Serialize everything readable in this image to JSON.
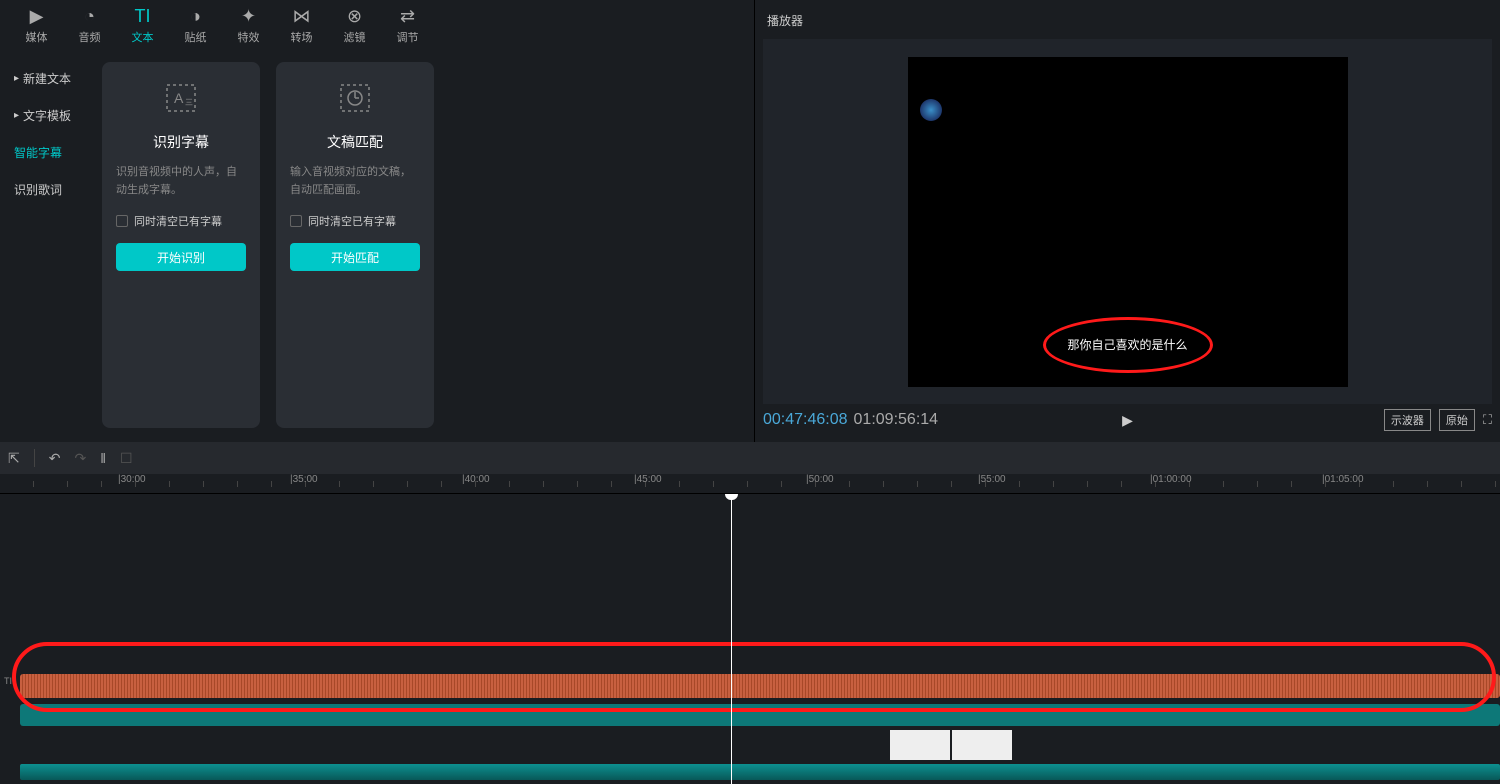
{
  "topTabs": [
    {
      "label": "媒体",
      "icon": "▶"
    },
    {
      "label": "音频",
      "icon": "◔"
    },
    {
      "label": "文本",
      "icon": "TI"
    },
    {
      "label": "贴纸",
      "icon": "◑"
    },
    {
      "label": "特效",
      "icon": "✦"
    },
    {
      "label": "转场",
      "icon": "⋈"
    },
    {
      "label": "滤镜",
      "icon": "⊗"
    },
    {
      "label": "调节",
      "icon": "⇄"
    }
  ],
  "sideMenu": [
    {
      "label": "新建文本",
      "caret": true
    },
    {
      "label": "文字模板",
      "caret": true
    },
    {
      "label": "智能字幕",
      "caret": false,
      "active": true
    },
    {
      "label": "识别歌词",
      "caret": false
    }
  ],
  "cards": [
    {
      "title": "识别字幕",
      "desc": "识别音视频中的人声，自动生成字幕。",
      "check": "同时清空已有字幕",
      "btn": "开始识别"
    },
    {
      "title": "文稿匹配",
      "desc": "输入音视频对应的文稿，自动匹配画面。",
      "check": "同时清空已有字幕",
      "btn": "开始匹配"
    }
  ],
  "player": {
    "title": "播放器",
    "subtitle": "那你自己喜欢的是什么",
    "currentTime": "00:47:46:08",
    "totalTime": "01:09:56:14",
    "btnA": "示波器",
    "btnB": "原始"
  },
  "ruler": [
    "|30:00",
    "|35:00",
    "|40:00",
    "|45:00",
    "|50:00",
    "|55:00",
    "|01:00:00",
    "|01:05:00"
  ],
  "playheadPx": 731
}
